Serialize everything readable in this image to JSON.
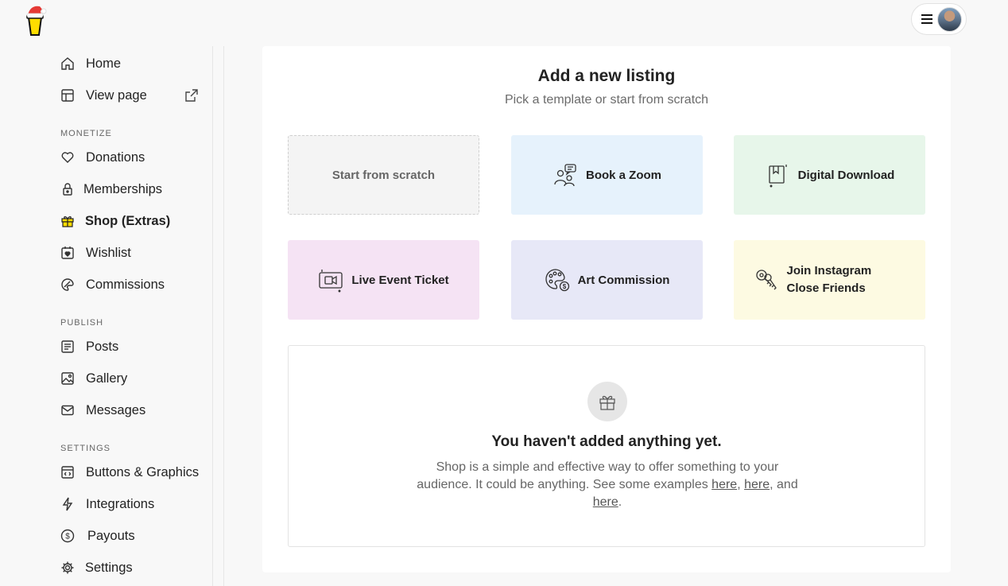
{
  "header": {
    "logo_icon": "buy-me-a-coffee-cup-santa-hat-icon",
    "menu_icon": "hamburger-menu-icon",
    "avatar_icon": "user-avatar"
  },
  "sidebar": {
    "items_top": [
      {
        "label": "Home",
        "icon": "home-icon"
      },
      {
        "label": "View page",
        "icon": "layout-icon"
      }
    ],
    "sections": [
      {
        "label": "MONETIZE",
        "items": [
          {
            "label": "Donations",
            "icon": "heart-icon"
          },
          {
            "label": "Memberships",
            "icon": "lock-icon"
          },
          {
            "label": "Shop (Extras)",
            "icon": "gift-icon",
            "active": true
          },
          {
            "label": "Wishlist",
            "icon": "calendar-heart-icon"
          },
          {
            "label": "Commissions",
            "icon": "palette-icon"
          }
        ]
      },
      {
        "label": "PUBLISH",
        "items": [
          {
            "label": "Posts",
            "icon": "document-icon"
          },
          {
            "label": "Gallery",
            "icon": "image-icon"
          },
          {
            "label": "Messages",
            "icon": "envelope-icon"
          }
        ]
      },
      {
        "label": "SETTINGS",
        "items": [
          {
            "label": "Buttons & Graphics",
            "icon": "code-window-icon"
          },
          {
            "label": "Integrations",
            "icon": "lightning-icon"
          },
          {
            "label": "Payouts",
            "icon": "dollar-icon"
          },
          {
            "label": "Settings",
            "icon": "gear-icon"
          }
        ]
      }
    ]
  },
  "main": {
    "title": "Add a new listing",
    "subtitle": "Pick a template or start from scratch",
    "templates": [
      {
        "label": "Start from scratch",
        "color": "#f4f4f4"
      },
      {
        "label": "Book a Zoom",
        "icon": "people-chat-icon",
        "color": "#e6f2fc"
      },
      {
        "label": "Digital Download",
        "icon": "download-bookmark-icon",
        "color": "#e7f6ea"
      },
      {
        "label": "Live Event Ticket",
        "icon": "video-camera-icon",
        "color": "#f5e3f4"
      },
      {
        "label": "Art Commission",
        "icon": "palette-dollar-icon",
        "color": "#e7e8f7"
      },
      {
        "label": "Join Instagram Close Friends",
        "icon": "keys-icon",
        "color": "#fdfae2"
      }
    ],
    "empty_state": {
      "icon": "gift-icon",
      "title": "You haven't added anything yet.",
      "text_before": "Shop is a simple and effective way to offer something to your audience. It could be anything. See some examples ",
      "link1": "here",
      "sep1": ", ",
      "link2": "here",
      "sep2": ", and ",
      "link3": "here",
      "end": "."
    }
  }
}
